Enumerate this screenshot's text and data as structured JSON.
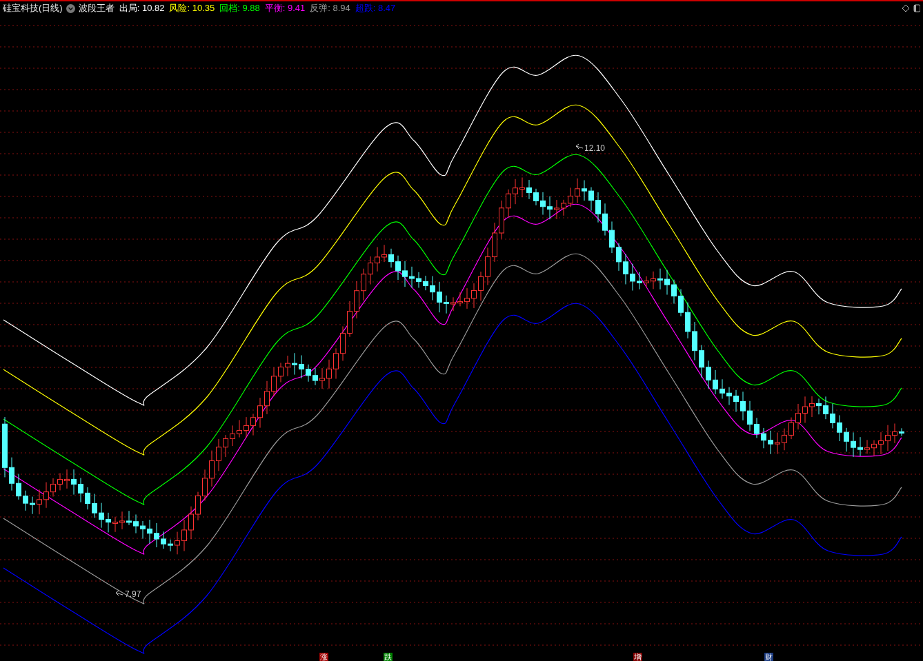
{
  "header": {
    "title": "硅宝科技(日线)",
    "indicator": "波段王者",
    "legend": [
      {
        "text": "出局: 10.82",
        "color": "#ffffff"
      },
      {
        "text": "风险: 10.35",
        "color": "#ffff00"
      },
      {
        "text": "回档: 9.88",
        "color": "#00ff00"
      },
      {
        "text": "平衡: 9.41",
        "color": "#ff00ff"
      },
      {
        "text": "反弹: 8.94",
        "color": "#9a9a9a"
      },
      {
        "text": "超跌: 8.47",
        "color": "#0000ff"
      }
    ]
  },
  "price_labels": [
    {
      "text": "12.10"
    },
    {
      "text": "7.97"
    }
  ],
  "markers": [
    {
      "text": "涨",
      "color": "#a00000"
    },
    {
      "text": "跌",
      "color": "#008000"
    },
    {
      "text": "增",
      "color": "#800000"
    },
    {
      "text": "财",
      "color": "#1a3a80"
    }
  ]
}
